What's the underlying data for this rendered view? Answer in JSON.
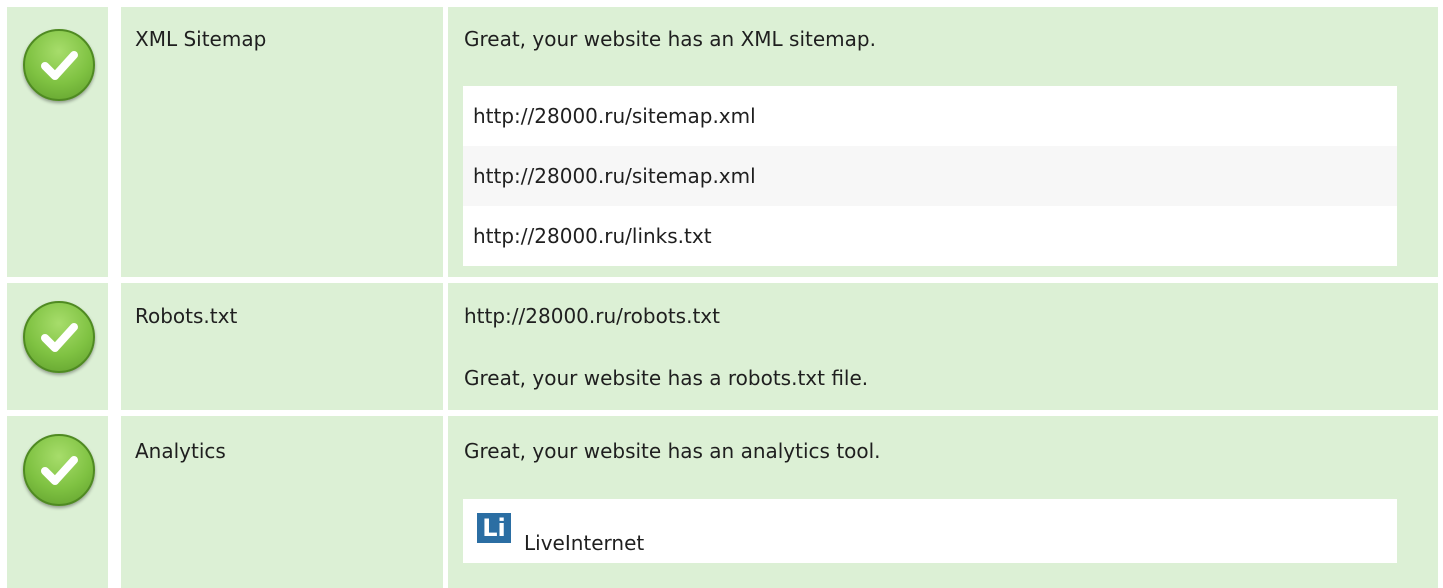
{
  "rows": [
    {
      "label": "XML Sitemap",
      "status_icon": "check-icon",
      "message": "Great, your website has an XML sitemap.",
      "sitemaps": [
        "http://28000.ru/sitemap.xml",
        "http://28000.ru/sitemap.xml",
        "http://28000.ru/links.txt"
      ]
    },
    {
      "label": "Robots.txt",
      "status_icon": "check-icon",
      "url": "http://28000.ru/robots.txt",
      "message": "Great, your website has a robots.txt file."
    },
    {
      "label": "Analytics",
      "status_icon": "check-icon",
      "message": "Great, your website has an analytics tool.",
      "tools": [
        {
          "icon": "liveinternet-logo",
          "logo_text": "Li",
          "name": "LiveInternet"
        }
      ]
    }
  ],
  "colors": {
    "row_background": "#dcf0d5",
    "check_green": "#7fc242",
    "list_background": "#ffffff",
    "list_alt_background": "#f7f7f7"
  }
}
